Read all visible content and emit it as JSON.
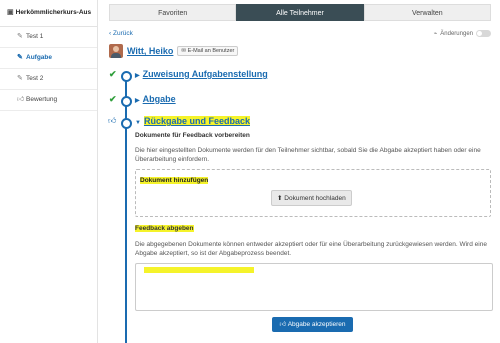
{
  "sidebar": {
    "course_title": "Herkömmlicherkurs-Aus",
    "items": [
      {
        "label": "Test 1",
        "icon": "edit-icon"
      },
      {
        "label": "Aufgabe",
        "icon": "edit-icon"
      },
      {
        "label": "Test 2",
        "icon": "edit-icon"
      },
      {
        "label": "Bewertung",
        "icon": "thumbs-up-icon"
      }
    ]
  },
  "tabs": [
    {
      "label": "Favoriten"
    },
    {
      "label": "Alle Teilnehmer"
    },
    {
      "label": "Verwalten"
    }
  ],
  "header": {
    "back_label": "Zurück",
    "changes_label": "Änderungen"
  },
  "user": {
    "name": "Witt, Heiko",
    "mail_label": "E-Mail an Benutzer"
  },
  "steps": [
    {
      "label": "Zuweisung Aufgabenstellung"
    },
    {
      "label": "Abgabe"
    },
    {
      "label": "Rückgabe und Feedback"
    }
  ],
  "feedback": {
    "prepare_heading": "Dokumente für Feedback vorbereiten",
    "prepare_text": "Die hier eingestellten Dokumente werden für den Teilnehmer sichtbar, sobald Sie die Abgabe akzeptiert haben oder eine Überarbeitung einfordern.",
    "add_doc_heading": "Dokument hinzufügen",
    "upload_label": "Dokument hochladen",
    "give_heading": "Feedback abgeben",
    "give_text": "Die abgegebenen Dokumente können entweder akzeptiert oder für eine Überarbeitung zurückgewiesen werden. Wird eine Abgabe akzeptiert, so ist der Abgabeprozess beendet.",
    "accept_label": "Abgabe akzeptieren"
  },
  "colors": {
    "accent": "#1a6bb0",
    "highlight": "#f5f32a",
    "active_tab": "#3a4d55",
    "check": "#2e9e3a"
  }
}
